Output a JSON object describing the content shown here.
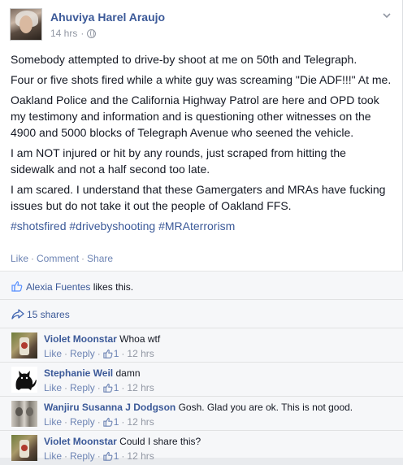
{
  "post": {
    "author": "Ahuviya Harel Araujo",
    "time": "14 hrs",
    "meta_separator": "·",
    "paragraphs": [
      "Somebody attempted to drive-by shoot at me on 50th and Telegraph.",
      "Four or five shots fired while a white guy was screaming \"Die ADF!!!\" At me.",
      "Oakland Police and the California Highway Patrol are here and OPD took my testimony and information and is questioning other witnesses on the 4900 and 5000 blocks of Telegraph Avenue who seened the vehicle.",
      "I am NOT injured or hit by any rounds, just scraped from hitting the sidewalk and not a half second too late.",
      "I am scared. I understand that these Gamergaters and MRAs have fucking issues but do not take it out the people of Oakland FFS."
    ],
    "hashtags": "#shotsfired #drivebyshooting #MRAterrorism",
    "actions": {
      "like": "Like",
      "comment": "Comment",
      "share": "Share",
      "separator": "·"
    }
  },
  "ufi": {
    "likes": {
      "name": "Alexia Fuentes",
      "suffix": " likes this."
    },
    "shares": "15 shares",
    "comments": [
      {
        "author": "Violet Moonstar",
        "text": "Whoa wtf",
        "like": "Like",
        "reply": "Reply",
        "like_count": "1",
        "time": "12 hrs",
        "avatar": "violet-avatar"
      },
      {
        "author": "Stephanie Weil",
        "text": "damn",
        "like": "Like",
        "reply": "Reply",
        "like_count": "1",
        "time": "12 hrs",
        "avatar": "black-cat-avatar"
      },
      {
        "author": "Wanjiru Susanna J Dodgson",
        "text": "Gosh. Glad you are ok. This is not good.",
        "like": "Like",
        "reply": "Reply",
        "like_count": "1",
        "time": "12 hrs",
        "avatar": "photo-avatar"
      },
      {
        "author": "Violet Moonstar",
        "text": "Could I share this?",
        "like": "Like",
        "reply": "Reply",
        "like_count": "1",
        "time": "12 hrs",
        "avatar": "violet-avatar"
      }
    ]
  },
  "colors": {
    "link": "#3b5998",
    "muted": "#9197a3",
    "action": "#6d84b4",
    "ufi_bg": "#f6f7f9"
  },
  "icons": [
    "globe-icon",
    "chevron-down-icon",
    "like-thumb-icon",
    "share-arrow-icon"
  ]
}
